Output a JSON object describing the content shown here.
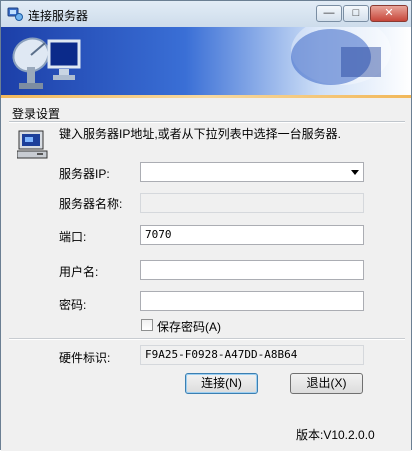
{
  "window": {
    "title": "连接服务器",
    "controls": {
      "minimize": "—",
      "maximize": "□",
      "close": "✕"
    }
  },
  "group": {
    "title": "登录设置"
  },
  "description": "键入服务器IP地址,或者从下拉列表中选择一台服务器.",
  "fields": {
    "server_ip": {
      "label": "服务器IP:",
      "value": ""
    },
    "server_name": {
      "label": "服务器名称:",
      "value": ""
    },
    "port": {
      "label": "端口:",
      "value": "7070"
    },
    "username": {
      "label": "用户名:",
      "value": ""
    },
    "password": {
      "label": "密码:",
      "value": ""
    }
  },
  "save_password": {
    "label": "保存密码(A)",
    "checked": false
  },
  "hardware_id": {
    "label": "硬件标识:",
    "value": "F9A25-F0928-A47DD-A8B64"
  },
  "buttons": {
    "connect": "连接(N)",
    "exit": "退出(X)"
  },
  "version": "版本:V10.2.0.0",
  "colors": {
    "banner_start": "#1c3fa8",
    "banner_mid": "#3a6fd6",
    "accent_line": "#f2b85a"
  }
}
